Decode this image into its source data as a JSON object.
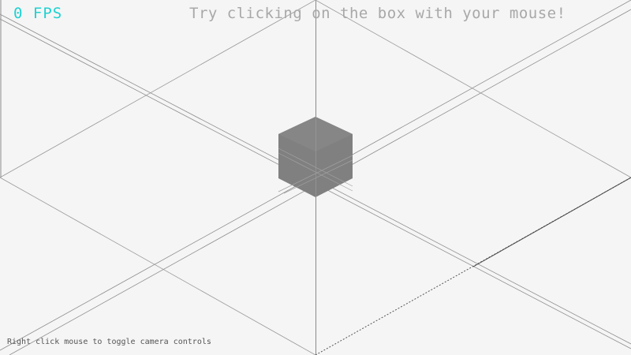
{
  "hud": {
    "fps": "0 FPS",
    "instruction": "Try clicking on the box with your mouse!",
    "camera_hint": "Right click mouse to toggle camera controls"
  },
  "scene": {
    "background_color": "#f5f5f5",
    "grid_line_color": "#8a8a8a",
    "cube_color": "#808080",
    "fps_color": "#1fd1d1",
    "instruction_color": "#a8a8a8",
    "hint_color": "#555555"
  }
}
